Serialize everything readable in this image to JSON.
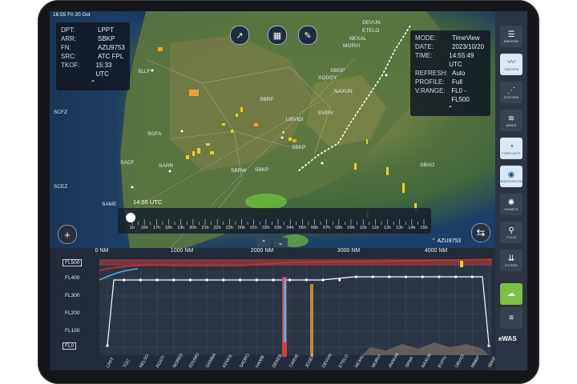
{
  "status_bar": {
    "time": "16:55",
    "date": "Fri 20 Oct"
  },
  "flight_info": {
    "rows": [
      {
        "k": "DPT:",
        "v": "LPPT"
      },
      {
        "k": "ARR:",
        "v": "SBKP"
      },
      {
        "k": "FN:",
        "v": "AZU9753"
      },
      {
        "k": "SRC:",
        "v": "ATC FPL"
      },
      {
        "k": "TKOF:",
        "v": "15:33 UTC"
      }
    ]
  },
  "view_info": {
    "rows": [
      {
        "k": "MODE:",
        "v": "TimeView"
      },
      {
        "k": "DATE:",
        "v": "2023/10/20"
      },
      {
        "k": "TIME:",
        "v": "14:55:49 UTC"
      },
      {
        "k": "REFRESH:",
        "v": "Auto"
      },
      {
        "k": "PROFILE:",
        "v": "Full"
      },
      {
        "k": "V.RANGE:",
        "v": "FL0 - FL500"
      }
    ]
  },
  "map_labels": [
    {
      "t": "SLLF"
    },
    {
      "t": "SCFZ"
    },
    {
      "t": "SGFA"
    },
    {
      "t": "SACF"
    },
    {
      "t": "SARR"
    },
    {
      "t": "SCEZ"
    },
    {
      "t": "SAME"
    },
    {
      "t": "SBRF"
    },
    {
      "t": "SBGP"
    },
    {
      "t": "XQDOY"
    },
    {
      "t": "NAXUN"
    },
    {
      "t": "EVPIV"
    },
    {
      "t": "UBVIDI"
    },
    {
      "t": "SBKP"
    },
    {
      "t": "SBRW"
    },
    {
      "t": "SBKP"
    },
    {
      "t": "SBAO"
    },
    {
      "t": "DEVUN"
    },
    {
      "t": "ETELO"
    },
    {
      "t": "NEXAL"
    },
    {
      "t": "MORVI"
    }
  ],
  "timeline": {
    "label": "14:55 UTC",
    "ticks": [
      "1h",
      "16h",
      "17h",
      "18h",
      "19h",
      "20h",
      "21h",
      "22h",
      "23h",
      "00h",
      "01h",
      "02h",
      "03h",
      "04h",
      "05h",
      "06h",
      "07h",
      "08h",
      "09h",
      "10h",
      "11h",
      "12h",
      "13h",
      "14h",
      "15h"
    ]
  },
  "flight_tag": "AZU9753",
  "profile": {
    "fl_top_box": "FL500",
    "fl_bottom_box": "FL0",
    "fl_labels": [
      "FL400",
      "FL300",
      "FL200",
      "FL100"
    ],
    "nm_labels": [
      "0 NM",
      "1000 NM",
      "2000 NM",
      "3000 NM",
      "4000 NM"
    ],
    "waypoints": [
      "LPPT",
      "TOC",
      "NELSO",
      "ROSTI",
      "NORED",
      "EDUMO",
      "GAMBA",
      "KEMOL",
      "SADRO",
      "HANIB",
      "DEKEB",
      "CARVE",
      "JOSEP",
      "DEVUN",
      "ETELO",
      "NEXAL",
      "MORVI",
      "ANNUM",
      "SPAR",
      "NAXUN",
      "EVPIV",
      "UBVIDI",
      "MMBP",
      "SBKP"
    ]
  },
  "rail": [
    {
      "icon": "briefing-icon",
      "label": "BRIEFING",
      "glyph": "☰"
    },
    {
      "icon": "timeview-icon",
      "label": "TIMEVIEW",
      "glyph": "〰"
    },
    {
      "icon": "stations-icon",
      "label": "STATIONS",
      "glyph": "⋰"
    },
    {
      "icon": "winds-icon",
      "label": "WINDS",
      "glyph": "≋"
    },
    {
      "icon": "forecasts-icon",
      "label": "FORECASTS",
      "glyph": "◔"
    },
    {
      "icon": "observations-icon",
      "label": "OBSERVATIONS",
      "glyph": "◉"
    },
    {
      "icon": "sigmets-icon",
      "label": "SIGMETS",
      "glyph": "✺"
    },
    {
      "icon": "tools-icon",
      "label": "TOOLS",
      "glyph": "⚲"
    },
    {
      "icon": "filters-icon",
      "label": "FILTERS",
      "glyph": "⇊"
    }
  ],
  "brand": "eWAS",
  "colors": {
    "route": "#ffffff",
    "top_limit": "#d03030",
    "convective": "#e8d12a",
    "warning_orange": "#f0a030",
    "rail_bg": "#2b3442"
  }
}
